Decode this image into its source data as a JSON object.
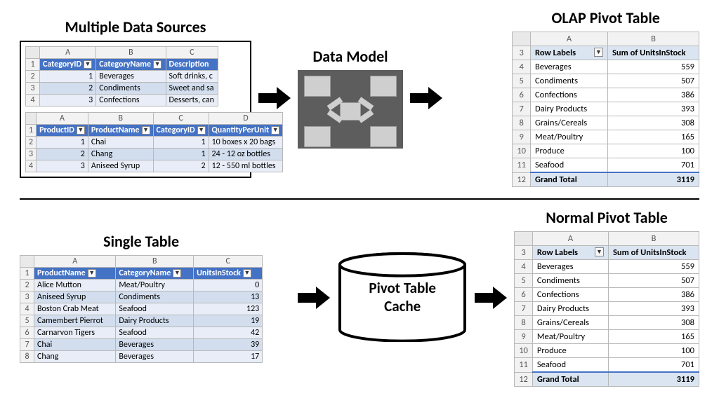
{
  "top": {
    "titles": {
      "left": "Multiple Data Sources",
      "mid": "Data Model",
      "right": "OLAP Pivot Table"
    },
    "categories": {
      "cols": {
        "a": "A",
        "b": "B",
        "c": "C"
      },
      "headers": {
        "id": "CategoryID",
        "name": "CategoryName",
        "desc": "Description"
      },
      "rows": [
        {
          "n": "1",
          "id": "1",
          "name": "Beverages",
          "desc": "Soft drinks, c"
        },
        {
          "n": "2",
          "id": "2",
          "name": "Condiments",
          "desc": "Sweet and sa"
        },
        {
          "n": "3",
          "id": "3",
          "name": "Confections",
          "desc": "Desserts, can"
        }
      ]
    },
    "products": {
      "cols": {
        "a": "A",
        "b": "B",
        "c": "C",
        "d": "D"
      },
      "headers": {
        "id": "ProductID",
        "name": "ProductName",
        "cat": "CategoryID",
        "qpu": "QuantityPerUnit"
      },
      "rows": [
        {
          "n": "1",
          "id": "1",
          "name": "Chai",
          "cat": "1",
          "qpu": "10 boxes x 20 bags"
        },
        {
          "n": "2",
          "id": "2",
          "name": "Chang",
          "cat": "1",
          "qpu": "24 - 12 oz bottles"
        },
        {
          "n": "3",
          "id": "3",
          "name": "Aniseed Syrup",
          "cat": "2",
          "qpu": "12 - 550 ml bottles"
        }
      ]
    }
  },
  "pivot": {
    "cols": {
      "a": "A",
      "b": "B"
    },
    "headerRow": "3",
    "rowLabelsHdr": "Row Labels",
    "valHdr": "Sum of UnitsInStock",
    "rows": [
      {
        "n": "4",
        "label": "Beverages",
        "val": "559"
      },
      {
        "n": "5",
        "label": "Condiments",
        "val": "507"
      },
      {
        "n": "6",
        "label": "Confections",
        "val": "386"
      },
      {
        "n": "7",
        "label": "Dairy Products",
        "val": "393"
      },
      {
        "n": "8",
        "label": "Grains/Cereals",
        "val": "308"
      },
      {
        "n": "9",
        "label": "Meat/Poultry",
        "val": "165"
      },
      {
        "n": "10",
        "label": "Produce",
        "val": "100"
      },
      {
        "n": "11",
        "label": "Seafood",
        "val": "701"
      }
    ],
    "totalRow": {
      "n": "12",
      "label": "Grand Total",
      "val": "3119"
    }
  },
  "bottom": {
    "titles": {
      "left": "Single Table",
      "mid_line1": "Pivot Table",
      "mid_line2": "Cache",
      "right": "Normal Pivot Table"
    },
    "single": {
      "cols": {
        "a": "A",
        "b": "B",
        "c": "C"
      },
      "headers": {
        "name": "ProductName",
        "cat": "CategoryName",
        "uis": "UnitsInStock"
      },
      "rows": [
        {
          "n": "1",
          "name": "Alice Mutton",
          "cat": "Meat/Poultry",
          "uis": "0"
        },
        {
          "n": "2",
          "name": "Aniseed Syrup",
          "cat": "Condiments",
          "uis": "13"
        },
        {
          "n": "3",
          "name": "Boston Crab Meat",
          "cat": "Seafood",
          "uis": "123"
        },
        {
          "n": "4",
          "name": "Camembert Pierrot",
          "cat": "Dairy Products",
          "uis": "19"
        },
        {
          "n": "5",
          "name": "Carnarvon Tigers",
          "cat": "Seafood",
          "uis": "42"
        },
        {
          "n": "6",
          "name": "Chai",
          "cat": "Beverages",
          "uis": "39"
        },
        {
          "n": "7",
          "name": "Chang",
          "cat": "Beverages",
          "uis": "17"
        }
      ]
    }
  },
  "chart_data": {
    "type": "table",
    "title": "Sum of UnitsInStock by CategoryName (OLAP / Normal pivot — identical output)",
    "categories": [
      "Beverages",
      "Condiments",
      "Confections",
      "Dairy Products",
      "Grains/Cereals",
      "Meat/Poultry",
      "Produce",
      "Seafood"
    ],
    "values": [
      559,
      507,
      386,
      393,
      308,
      165,
      100,
      701
    ],
    "grand_total": 3119
  }
}
